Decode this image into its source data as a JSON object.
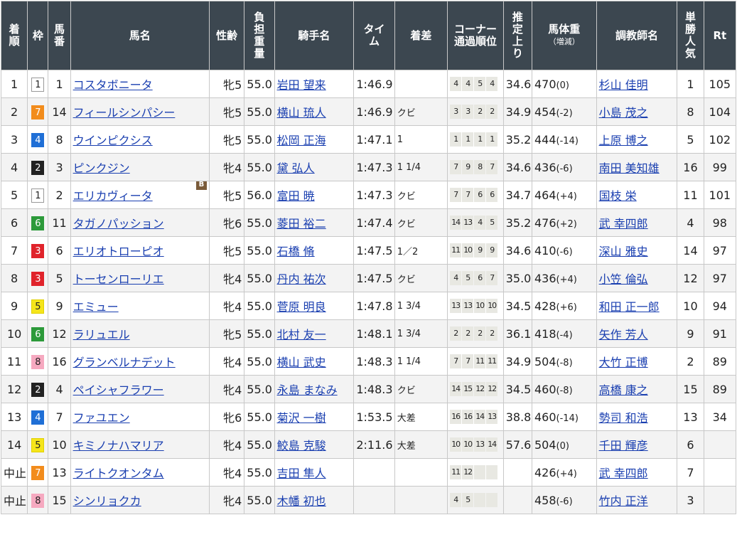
{
  "headers": {
    "rank": [
      "着",
      "順"
    ],
    "waku": "枠",
    "umaban": [
      "馬",
      "番"
    ],
    "horse": "馬名",
    "sexage": "性齢",
    "weight": [
      "負",
      "担",
      "重",
      "量"
    ],
    "jockey": "騎手名",
    "time": [
      "タイ",
      "ム"
    ],
    "margin": "着差",
    "corner": [
      "コーナー",
      "通過順位"
    ],
    "last3f": [
      "推",
      "定",
      "上",
      "り"
    ],
    "bodyweight": "馬体重",
    "bodyweight_sub": "（増減）",
    "trainer": "調教師名",
    "pop": [
      "単",
      "勝",
      "人",
      "気"
    ],
    "rt": "Rt"
  },
  "waku_colors": {
    "1": {
      "bg": "#ffffff",
      "fg": "#222222",
      "border": "#999999"
    },
    "2": {
      "bg": "#222222",
      "fg": "#ffffff",
      "border": "#222222"
    },
    "3": {
      "bg": "#e0232b",
      "fg": "#ffffff",
      "border": "#e0232b"
    },
    "4": {
      "bg": "#1f6fd6",
      "fg": "#ffffff",
      "border": "#1f6fd6"
    },
    "5": {
      "bg": "#f5e51b",
      "fg": "#222222",
      "border": "#e0d000"
    },
    "6": {
      "bg": "#2c9a3a",
      "fg": "#ffffff",
      "border": "#2c9a3a"
    },
    "7": {
      "bg": "#f28c1c",
      "fg": "#ffffff",
      "border": "#f28c1c"
    },
    "8": {
      "bg": "#f6a9c0",
      "fg": "#222222",
      "border": "#f6a9c0"
    }
  },
  "rows": [
    {
      "rank": "1",
      "waku": "1",
      "umaban": "1",
      "horse": "コスタボニータ",
      "blinker": "",
      "sexage": "牝5",
      "weight": "55.0",
      "jockey": "岩田 望来",
      "time": "1:46.9",
      "margin": "",
      "corner": [
        "4",
        "4",
        "5",
        "4"
      ],
      "last3f": "34.6",
      "bw": "470",
      "bwdiff": "(0)",
      "trainer": "杉山 佳明",
      "pop": "1",
      "rt": "105"
    },
    {
      "rank": "2",
      "waku": "7",
      "umaban": "14",
      "horse": "フィールシンパシー",
      "blinker": "",
      "sexage": "牝5",
      "weight": "55.0",
      "jockey": "横山 琉人",
      "time": "1:46.9",
      "margin": "クビ",
      "corner": [
        "3",
        "3",
        "2",
        "2"
      ],
      "last3f": "34.9",
      "bw": "454",
      "bwdiff": "(-2)",
      "trainer": "小島 茂之",
      "pop": "8",
      "rt": "104"
    },
    {
      "rank": "3",
      "waku": "4",
      "umaban": "8",
      "horse": "ウインピクシス",
      "blinker": "",
      "sexage": "牝5",
      "weight": "55.0",
      "jockey": "松岡 正海",
      "time": "1:47.1",
      "margin": "1",
      "corner": [
        "1",
        "1",
        "1",
        "1"
      ],
      "last3f": "35.2",
      "bw": "444",
      "bwdiff": "(-14)",
      "trainer": "上原 博之",
      "pop": "5",
      "rt": "102"
    },
    {
      "rank": "4",
      "waku": "2",
      "umaban": "3",
      "horse": "ピンクジン",
      "blinker": "",
      "sexage": "牝4",
      "weight": "55.0",
      "jockey": "黛 弘人",
      "time": "1:47.3",
      "margin": "1 1/4",
      "corner": [
        "7",
        "9",
        "8",
        "7"
      ],
      "last3f": "34.6",
      "bw": "436",
      "bwdiff": "(-6)",
      "trainer": "南田 美知雄",
      "pop": "16",
      "rt": "99"
    },
    {
      "rank": "5",
      "waku": "1",
      "umaban": "2",
      "horse": "エリカヴィータ",
      "blinker": "B",
      "sexage": "牝5",
      "weight": "56.0",
      "jockey": "富田 暁",
      "time": "1:47.3",
      "margin": "クビ",
      "corner": [
        "7",
        "7",
        "6",
        "6"
      ],
      "last3f": "34.7",
      "bw": "464",
      "bwdiff": "(+4)",
      "trainer": "国枝 栄",
      "pop": "11",
      "rt": "101"
    },
    {
      "rank": "6",
      "waku": "6",
      "umaban": "11",
      "horse": "タガノパッション",
      "blinker": "",
      "sexage": "牝6",
      "weight": "55.0",
      "jockey": "菱田 裕二",
      "time": "1:47.4",
      "margin": "クビ",
      "corner": [
        "14",
        "13",
        "4",
        "5"
      ],
      "last3f": "35.2",
      "bw": "476",
      "bwdiff": "(+2)",
      "trainer": "武 幸四郎",
      "pop": "4",
      "rt": "98"
    },
    {
      "rank": "7",
      "waku": "3",
      "umaban": "6",
      "horse": "エリオトローピオ",
      "blinker": "",
      "sexage": "牝5",
      "weight": "55.0",
      "jockey": "石橋 脩",
      "time": "1:47.5",
      "margin": "1／2",
      "corner": [
        "11",
        "10",
        "9",
        "9"
      ],
      "last3f": "34.6",
      "bw": "410",
      "bwdiff": "(-6)",
      "trainer": "深山 雅史",
      "pop": "14",
      "rt": "97"
    },
    {
      "rank": "8",
      "waku": "3",
      "umaban": "5",
      "horse": "トーセンローリエ",
      "blinker": "",
      "sexage": "牝4",
      "weight": "55.0",
      "jockey": "丹内 祐次",
      "time": "1:47.5",
      "margin": "クビ",
      "corner": [
        "4",
        "5",
        "6",
        "7"
      ],
      "last3f": "35.0",
      "bw": "436",
      "bwdiff": "(+4)",
      "trainer": "小笠 倫弘",
      "pop": "12",
      "rt": "97"
    },
    {
      "rank": "9",
      "waku": "5",
      "umaban": "9",
      "horse": "エミュー",
      "blinker": "",
      "sexage": "牝4",
      "weight": "55.0",
      "jockey": "菅原 明良",
      "time": "1:47.8",
      "margin": "1 3/4",
      "corner": [
        "13",
        "13",
        "10",
        "10"
      ],
      "last3f": "34.5",
      "bw": "428",
      "bwdiff": "(+6)",
      "trainer": "和田 正一郎",
      "pop": "10",
      "rt": "94"
    },
    {
      "rank": "10",
      "waku": "6",
      "umaban": "12",
      "horse": "ラリュエル",
      "blinker": "",
      "sexage": "牝5",
      "weight": "55.0",
      "jockey": "北村 友一",
      "time": "1:48.1",
      "margin": "1 3/4",
      "corner": [
        "2",
        "2",
        "2",
        "2"
      ],
      "last3f": "36.1",
      "bw": "418",
      "bwdiff": "(-4)",
      "trainer": "矢作 芳人",
      "pop": "9",
      "rt": "91"
    },
    {
      "rank": "11",
      "waku": "8",
      "umaban": "16",
      "horse": "グランベルナデット",
      "blinker": "",
      "sexage": "牝4",
      "weight": "55.0",
      "jockey": "横山 武史",
      "time": "1:48.3",
      "margin": "1 1/4",
      "corner": [
        "7",
        "7",
        "11",
        "11"
      ],
      "last3f": "34.9",
      "bw": "504",
      "bwdiff": "(-8)",
      "trainer": "大竹 正博",
      "pop": "2",
      "rt": "89"
    },
    {
      "rank": "12",
      "waku": "2",
      "umaban": "4",
      "horse": "ペイシャフラワー",
      "blinker": "",
      "sexage": "牝4",
      "weight": "55.0",
      "jockey": "永島 まなみ",
      "time": "1:48.3",
      "margin": "クビ",
      "corner": [
        "14",
        "15",
        "12",
        "12"
      ],
      "last3f": "34.5",
      "bw": "460",
      "bwdiff": "(-8)",
      "trainer": "高橋 康之",
      "pop": "15",
      "rt": "89"
    },
    {
      "rank": "13",
      "waku": "4",
      "umaban": "7",
      "horse": "ファユエン",
      "blinker": "",
      "sexage": "牝6",
      "weight": "55.0",
      "jockey": "菊沢 一樹",
      "time": "1:53.5",
      "margin": "大差",
      "corner": [
        "16",
        "16",
        "14",
        "13"
      ],
      "last3f": "38.8",
      "bw": "460",
      "bwdiff": "(-14)",
      "trainer": "勢司 和浩",
      "pop": "13",
      "rt": "34"
    },
    {
      "rank": "14",
      "waku": "5",
      "umaban": "10",
      "horse": "キミノナハマリア",
      "blinker": "",
      "sexage": "牝4",
      "weight": "55.0",
      "jockey": "鮫島 克駿",
      "time": "2:11.6",
      "margin": "大差",
      "corner": [
        "10",
        "10",
        "13",
        "14"
      ],
      "last3f": "57.6",
      "bw": "504",
      "bwdiff": "(0)",
      "trainer": "千田 輝彦",
      "pop": "6",
      "rt": ""
    },
    {
      "rank": "中止",
      "waku": "7",
      "umaban": "13",
      "horse": "ライトクオンタム",
      "blinker": "",
      "sexage": "牝4",
      "weight": "55.0",
      "jockey": "吉田 隼人",
      "time": "",
      "margin": "",
      "corner": [
        "11",
        "12",
        "",
        ""
      ],
      "last3f": "",
      "bw": "426",
      "bwdiff": "(+4)",
      "trainer": "武 幸四郎",
      "pop": "7",
      "rt": ""
    },
    {
      "rank": "中止",
      "waku": "8",
      "umaban": "15",
      "horse": "シンリョクカ",
      "blinker": "",
      "sexage": "牝4",
      "weight": "55.0",
      "jockey": "木幡 初也",
      "time": "",
      "margin": "",
      "corner": [
        "4",
        "5",
        "",
        ""
      ],
      "last3f": "",
      "bw": "458",
      "bwdiff": "(-6)",
      "trainer": "竹内 正洋",
      "pop": "3",
      "rt": ""
    }
  ]
}
